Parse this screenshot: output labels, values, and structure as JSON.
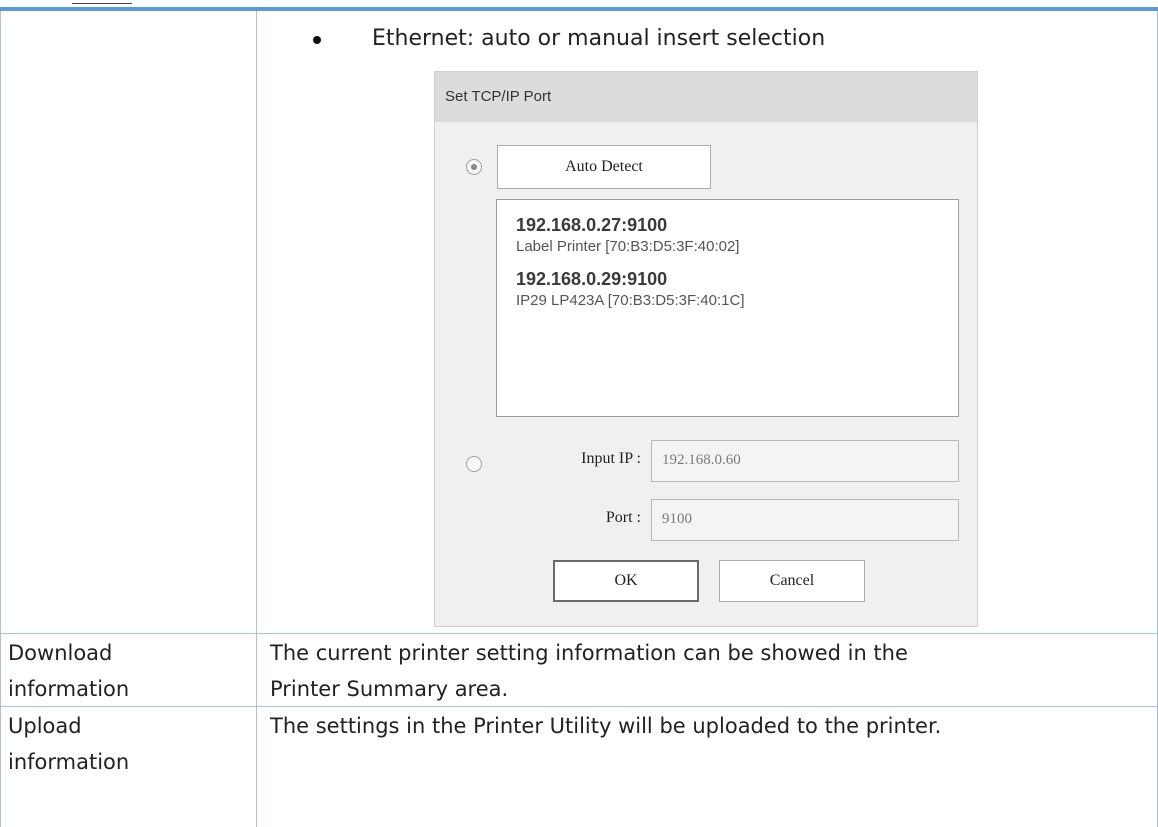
{
  "bullet_item": "Ethernet: auto or manual insert selection",
  "dialog": {
    "title": "Set TCP/IP Port",
    "auto_detect_label": "Auto Detect",
    "devices": [
      {
        "ip": "192.168.0.27:9100",
        "device": "Label Printer [70:B3:D5:3F:40:02]"
      },
      {
        "ip": "192.168.0.29:9100",
        "device": "IP29 LP423A [70:B3:D5:3F:40:1C]"
      }
    ],
    "input_ip_label": "Input IP :",
    "input_ip_value": "192.168.0.60",
    "port_label": "Port :",
    "port_value": "9100",
    "ok_label": "OK",
    "cancel_label": "Cancel"
  },
  "rows": [
    {
      "name_line1": "Download",
      "name_line2": "information",
      "desc_line1": "The current printer setting information can be showed in the",
      "desc_line2": "Printer Summary area."
    },
    {
      "name_line1": "Upload",
      "name_line2": "information",
      "desc_line1": "The settings in the Printer Utility will be uploaded to the printer.",
      "desc_line2": ""
    }
  ]
}
